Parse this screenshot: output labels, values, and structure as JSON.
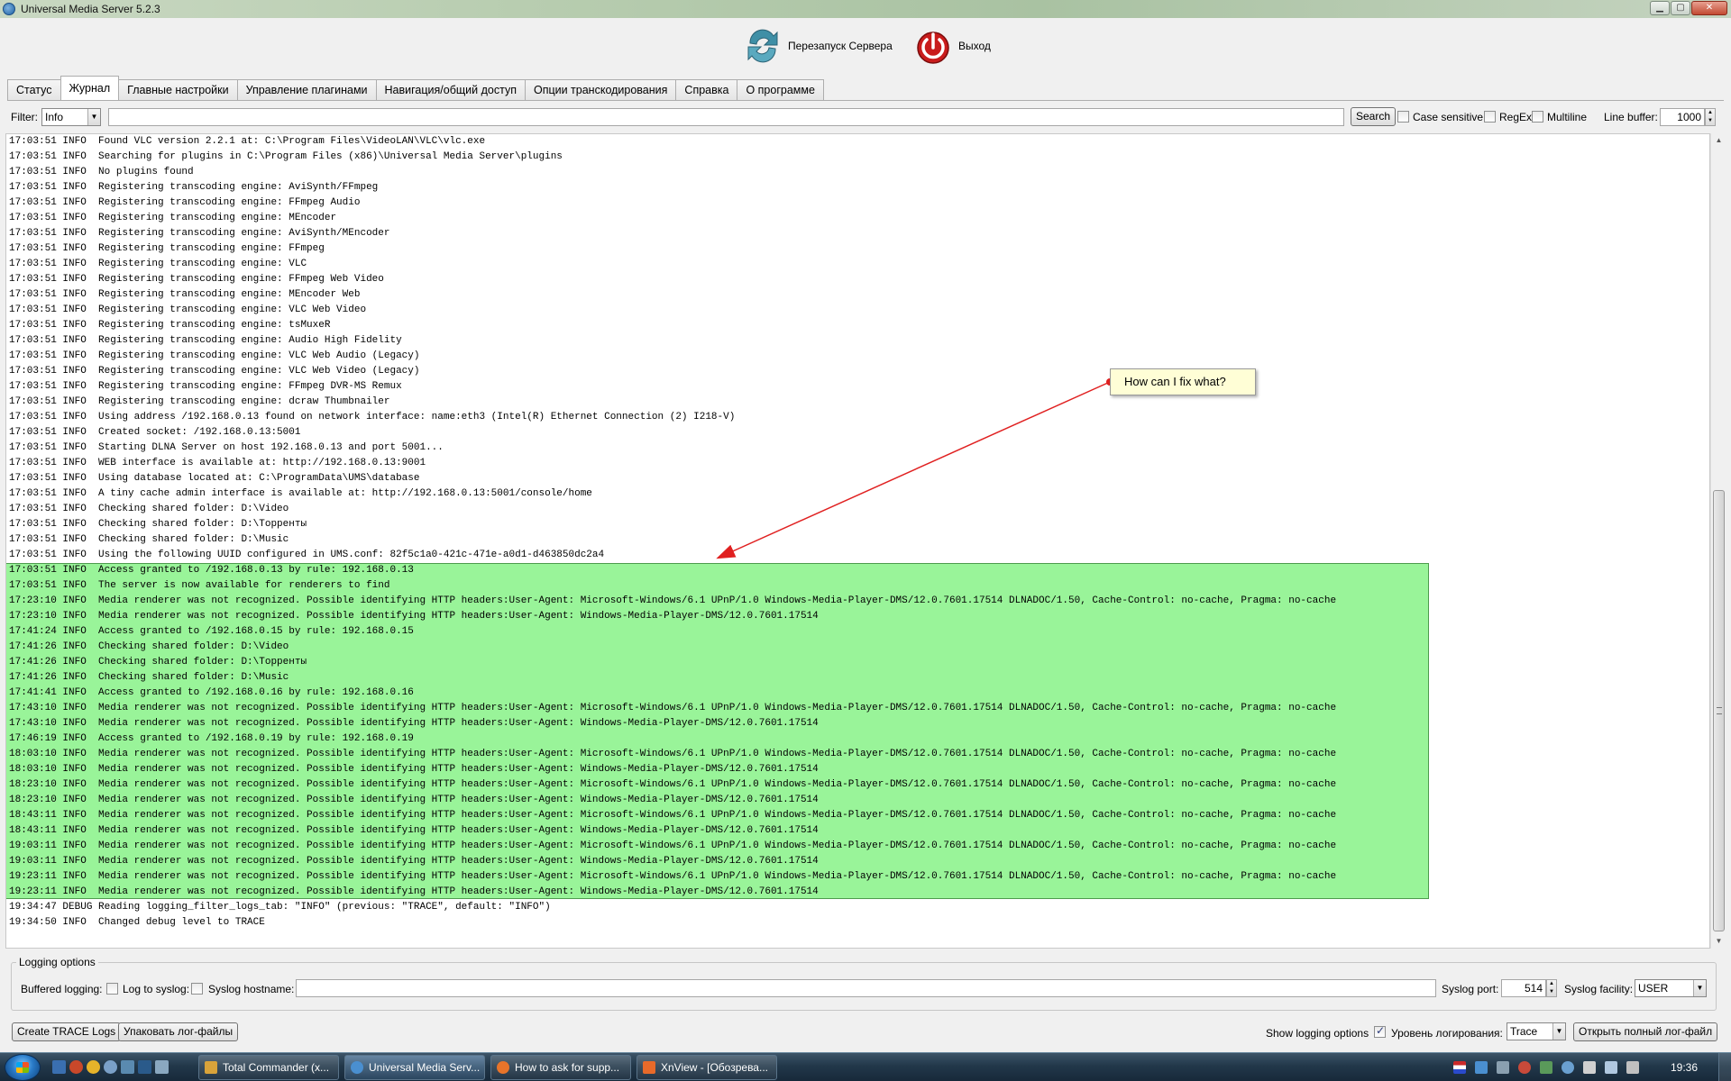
{
  "window": {
    "title": "Universal Media Server 5.2.3",
    "minimize": "▁",
    "maximize": "▢",
    "close": "✕"
  },
  "toolbar": {
    "restart_label": "Перезапуск Сервера",
    "exit_label": "Выход"
  },
  "tabs": [
    {
      "label": "Статус"
    },
    {
      "label": "Журнал",
      "active": true
    },
    {
      "label": "Главные настройки"
    },
    {
      "label": "Управление плагинами"
    },
    {
      "label": "Навигация/общий доступ"
    },
    {
      "label": "Опции транскодирования"
    },
    {
      "label": "Справка"
    },
    {
      "label": "О программе"
    }
  ],
  "filter": {
    "label": "Filter:",
    "level": "Info",
    "text": "",
    "search_label": "Search",
    "case_sensitive_label": "Case sensitive",
    "regex_label": "RegEx",
    "multiline_label": "Multiline",
    "line_buffer_label": "Line buffer:",
    "line_buffer_value": "1000"
  },
  "log": {
    "lines": [
      "17:03:51 INFO  Found VLC version 2.2.1 at: C:\\Program Files\\VideoLAN\\VLC\\vlc.exe",
      "17:03:51 INFO  Searching for plugins in C:\\Program Files (x86)\\Universal Media Server\\plugins",
      "17:03:51 INFO  No plugins found",
      "17:03:51 INFO  Registering transcoding engine: AviSynth/FFmpeg",
      "17:03:51 INFO  Registering transcoding engine: FFmpeg Audio",
      "17:03:51 INFO  Registering transcoding engine: MEncoder",
      "17:03:51 INFO  Registering transcoding engine: AviSynth/MEncoder",
      "17:03:51 INFO  Registering transcoding engine: FFmpeg",
      "17:03:51 INFO  Registering transcoding engine: VLC",
      "17:03:51 INFO  Registering transcoding engine: FFmpeg Web Video",
      "17:03:51 INFO  Registering transcoding engine: MEncoder Web",
      "17:03:51 INFO  Registering transcoding engine: VLC Web Video",
      "17:03:51 INFO  Registering transcoding engine: tsMuxeR",
      "17:03:51 INFO  Registering transcoding engine: Audio High Fidelity",
      "17:03:51 INFO  Registering transcoding engine: VLC Web Audio (Legacy)",
      "17:03:51 INFO  Registering transcoding engine: VLC Web Video (Legacy)",
      "17:03:51 INFO  Registering transcoding engine: FFmpeg DVR-MS Remux",
      "17:03:51 INFO  Registering transcoding engine: dcraw Thumbnailer",
      "17:03:51 INFO  Using address /192.168.0.13 found on network interface: name:eth3 (Intel(R) Ethernet Connection (2) I218-V)",
      "17:03:51 INFO  Created socket: /192.168.0.13:5001",
      "17:03:51 INFO  Starting DLNA Server on host 192.168.0.13 and port 5001...",
      "17:03:51 INFO  WEB interface is available at: http://192.168.0.13:9001",
      "17:03:51 INFO  Using database located at: C:\\ProgramData\\UMS\\database",
      "17:03:51 INFO  A tiny cache admin interface is available at: http://192.168.0.13:5001/console/home",
      "17:03:51 INFO  Checking shared folder: D:\\Video",
      "17:03:51 INFO  Checking shared folder: D:\\Торренты",
      "17:03:51 INFO  Checking shared folder: D:\\Music",
      "17:03:51 INFO  Using the following UUID configured in UMS.conf: 82f5c1a0-421c-471e-a0d1-d463850dc2a4",
      "17:03:51 INFO  Access granted to /192.168.0.13 by rule: 192.168.0.13",
      "17:03:51 INFO  The server is now available for renderers to find",
      "17:23:10 INFO  Media renderer was not recognized. Possible identifying HTTP headers:User-Agent: Microsoft-Windows/6.1 UPnP/1.0 Windows-Media-Player-DMS/12.0.7601.17514 DLNADOC/1.50, Cache-Control: no-cache, Pragma: no-cache",
      "17:23:10 INFO  Media renderer was not recognized. Possible identifying HTTP headers:User-Agent: Windows-Media-Player-DMS/12.0.7601.17514",
      "17:41:24 INFO  Access granted to /192.168.0.15 by rule: 192.168.0.15",
      "17:41:26 INFO  Checking shared folder: D:\\Video",
      "17:41:26 INFO  Checking shared folder: D:\\Торренты",
      "17:41:26 INFO  Checking shared folder: D:\\Music",
      "17:41:41 INFO  Access granted to /192.168.0.16 by rule: 192.168.0.16",
      "17:43:10 INFO  Media renderer was not recognized. Possible identifying HTTP headers:User-Agent: Microsoft-Windows/6.1 UPnP/1.0 Windows-Media-Player-DMS/12.0.7601.17514 DLNADOC/1.50, Cache-Control: no-cache, Pragma: no-cache",
      "17:43:10 INFO  Media renderer was not recognized. Possible identifying HTTP headers:User-Agent: Windows-Media-Player-DMS/12.0.7601.17514",
      "17:46:19 INFO  Access granted to /192.168.0.19 by rule: 192.168.0.19",
      "18:03:10 INFO  Media renderer was not recognized. Possible identifying HTTP headers:User-Agent: Microsoft-Windows/6.1 UPnP/1.0 Windows-Media-Player-DMS/12.0.7601.17514 DLNADOC/1.50, Cache-Control: no-cache, Pragma: no-cache",
      "18:03:10 INFO  Media renderer was not recognized. Possible identifying HTTP headers:User-Agent: Windows-Media-Player-DMS/12.0.7601.17514",
      "18:23:10 INFO  Media renderer was not recognized. Possible identifying HTTP headers:User-Agent: Microsoft-Windows/6.1 UPnP/1.0 Windows-Media-Player-DMS/12.0.7601.17514 DLNADOC/1.50, Cache-Control: no-cache, Pragma: no-cache",
      "18:23:10 INFO  Media renderer was not recognized. Possible identifying HTTP headers:User-Agent: Windows-Media-Player-DMS/12.0.7601.17514",
      "18:43:11 INFO  Media renderer was not recognized. Possible identifying HTTP headers:User-Agent: Microsoft-Windows/6.1 UPnP/1.0 Windows-Media-Player-DMS/12.0.7601.17514 DLNADOC/1.50, Cache-Control: no-cache, Pragma: no-cache",
      "18:43:11 INFO  Media renderer was not recognized. Possible identifying HTTP headers:User-Agent: Windows-Media-Player-DMS/12.0.7601.17514",
      "19:03:11 INFO  Media renderer was not recognized. Possible identifying HTTP headers:User-Agent: Microsoft-Windows/6.1 UPnP/1.0 Windows-Media-Player-DMS/12.0.7601.17514 DLNADOC/1.50, Cache-Control: no-cache, Pragma: no-cache",
      "19:03:11 INFO  Media renderer was not recognized. Possible identifying HTTP headers:User-Agent: Windows-Media-Player-DMS/12.0.7601.17514",
      "19:23:11 INFO  Media renderer was not recognized. Possible identifying HTTP headers:User-Agent: Microsoft-Windows/6.1 UPnP/1.0 Windows-Media-Player-DMS/12.0.7601.17514 DLNADOC/1.50, Cache-Control: no-cache, Pragma: no-cache",
      "19:23:11 INFO  Media renderer was not recognized. Possible identifying HTTP headers:User-Agent: Windows-Media-Player-DMS/12.0.7601.17514",
      "19:34:47 DEBUG Reading logging_filter_logs_tab: \"INFO\" (previous: \"TRACE\", default: \"INFO\")",
      "19:34:50 INFO  Changed debug level to TRACE"
    ],
    "highlight_color": "#6ef06e"
  },
  "annotation": {
    "text": "How can I fix what?",
    "arrow_color": "#e02020"
  },
  "logging_options": {
    "legend": "Logging options",
    "buffered_label": "Buffered logging:",
    "syslog_label": "Log to syslog:",
    "syslog_host_label": "Syslog hostname:",
    "syslog_host_value": "",
    "syslog_port_label": "Syslog port:",
    "syslog_port_value": "514",
    "syslog_facility_label": "Syslog facility:",
    "syslog_facility_value": "USER"
  },
  "bottom": {
    "create_trace_label": "Create TRACE Logs",
    "pack_logs_label": "Упаковать лог-файлы",
    "show_logging_label": "Show logging options",
    "log_level_label": "Уровень логирования:",
    "log_level_value": "Trace",
    "open_full_log_label": "Открыть полный лог-файл"
  },
  "taskbar": {
    "tasks": [
      {
        "label": "Total Commander (x...",
        "icon_color": "#d9a33a"
      },
      {
        "label": "Universal Media Serv...",
        "icon_color": "#4a8fd0",
        "active": true
      },
      {
        "label": "How to ask for supp...",
        "icon_color": "#e8742a"
      },
      {
        "label": "XnView - [Обозрева...",
        "icon_color": "#e86a2a"
      }
    ],
    "clock": "19:36"
  }
}
